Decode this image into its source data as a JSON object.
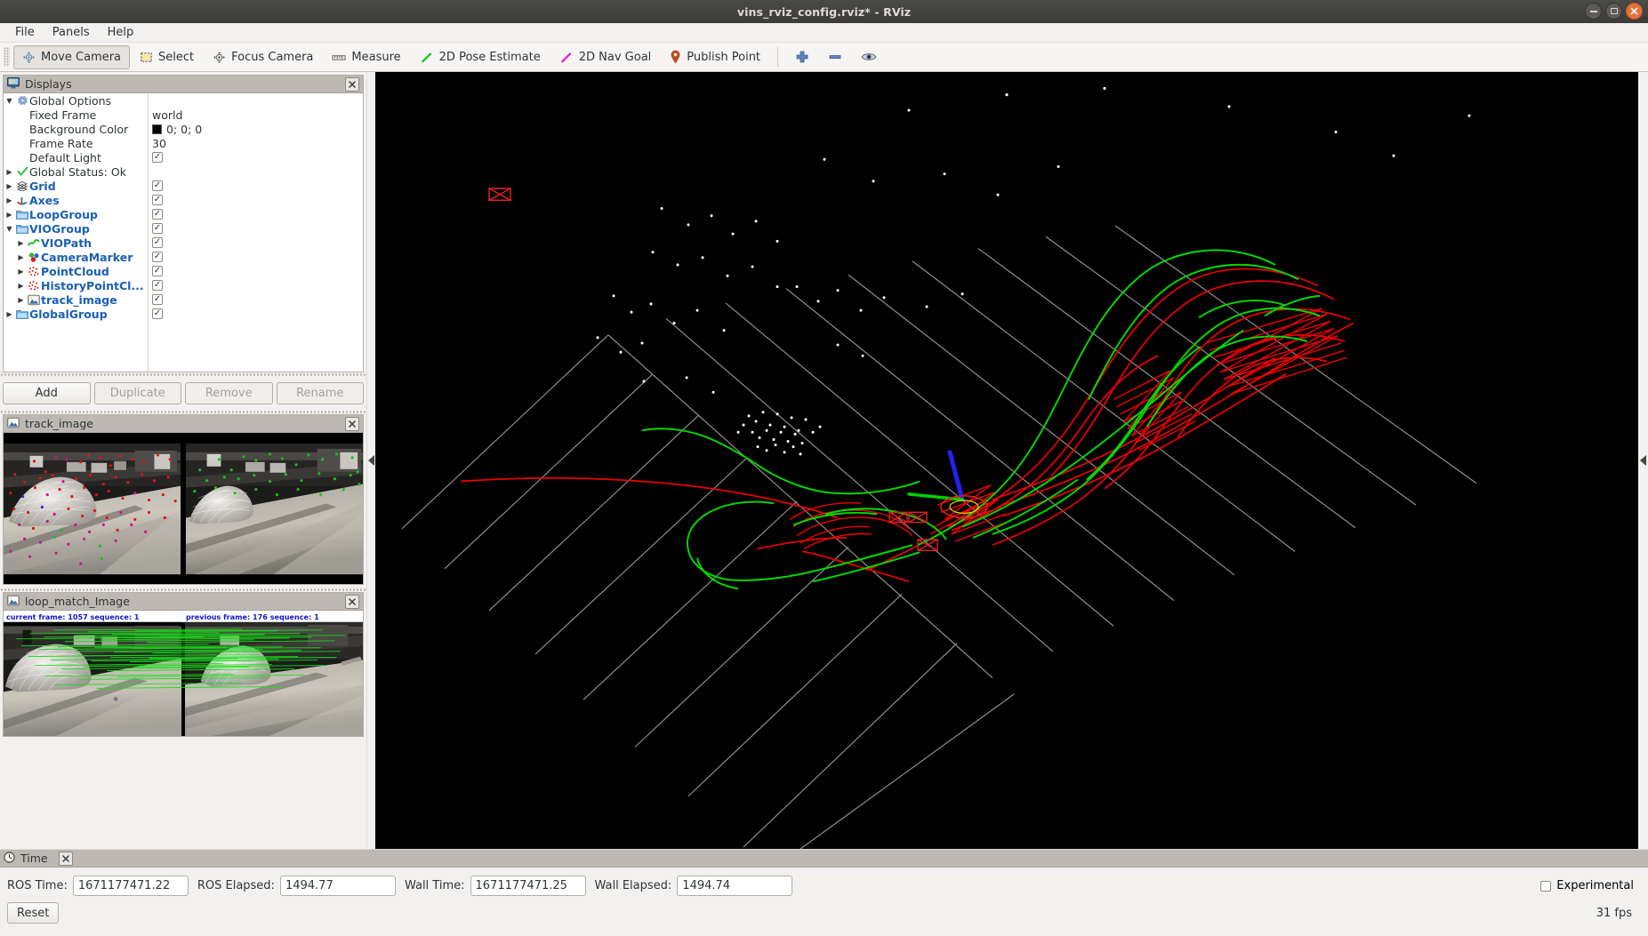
{
  "window": {
    "title": "vins_rviz_config.rviz* - RViz",
    "controls": {
      "minimize": "minimize-icon",
      "maximize": "maximize-icon",
      "close": "close-icon"
    }
  },
  "menu": {
    "items": [
      "File",
      "Panels",
      "Help"
    ]
  },
  "toolbar": {
    "buttons": [
      {
        "label": "Move Camera",
        "icon": "move-camera-icon",
        "active": true
      },
      {
        "label": "Select",
        "icon": "select-icon",
        "active": false
      },
      {
        "label": "Focus Camera",
        "icon": "focus-camera-icon",
        "active": false
      },
      {
        "label": "Measure",
        "icon": "measure-icon",
        "active": false
      },
      {
        "label": "2D Pose Estimate",
        "icon": "pose-estimate-icon",
        "active": false
      },
      {
        "label": "2D Nav Goal",
        "icon": "nav-goal-icon",
        "active": false
      },
      {
        "label": "Publish Point",
        "icon": "publish-point-icon",
        "active": false
      }
    ],
    "extra_icons": [
      "plus-icon",
      "minus-icon",
      "eye-icon"
    ]
  },
  "displays": {
    "panel_title": "Displays",
    "panel_icon": "display-monitor-icon",
    "close_label": "×",
    "tree": [
      {
        "indent": 0,
        "twisty": "down",
        "icon": "gear-icon",
        "label": "Global Options",
        "blue": false,
        "value_type": "none"
      },
      {
        "indent": 0,
        "twisty": "none",
        "icon": "none",
        "label": "Fixed Frame",
        "blue": false,
        "value_type": "text",
        "value": "world"
      },
      {
        "indent": 0,
        "twisty": "none",
        "icon": "none",
        "label": "Background Color",
        "blue": false,
        "value_type": "color",
        "value": "0; 0; 0",
        "color": "#000000"
      },
      {
        "indent": 0,
        "twisty": "none",
        "icon": "none",
        "label": "Frame Rate",
        "blue": false,
        "value_type": "text",
        "value": "30"
      },
      {
        "indent": 0,
        "twisty": "none",
        "icon": "none",
        "label": "Default Light",
        "blue": false,
        "value_type": "check",
        "checked": true
      },
      {
        "indent": 0,
        "twisty": "right",
        "icon": "check-icon",
        "label": "Global Status: Ok",
        "blue": false,
        "value_type": "none"
      },
      {
        "indent": 0,
        "twisty": "right",
        "icon": "grid-icon",
        "label": "Grid",
        "blue": true,
        "value_type": "check",
        "checked": true
      },
      {
        "indent": 0,
        "twisty": "right",
        "icon": "axes-icon",
        "label": "Axes",
        "blue": true,
        "value_type": "check",
        "checked": true
      },
      {
        "indent": 0,
        "twisty": "right",
        "icon": "folder-icon",
        "label": "LoopGroup",
        "blue": true,
        "value_type": "check",
        "checked": true
      },
      {
        "indent": 0,
        "twisty": "down",
        "icon": "folder-icon",
        "label": "VIOGroup",
        "blue": true,
        "value_type": "check",
        "checked": true
      },
      {
        "indent": 1,
        "twisty": "right",
        "icon": "path-icon",
        "label": "VIOPath",
        "blue": true,
        "value_type": "check",
        "checked": true
      },
      {
        "indent": 1,
        "twisty": "right",
        "icon": "marker-icon",
        "label": "CameraMarker",
        "blue": true,
        "value_type": "check",
        "checked": true
      },
      {
        "indent": 1,
        "twisty": "right",
        "icon": "pointcloud-icon",
        "label": "PointCloud",
        "blue": true,
        "value_type": "check",
        "checked": true
      },
      {
        "indent": 1,
        "twisty": "right",
        "icon": "pointcloud-icon",
        "label": "HistoryPointCl...",
        "blue": true,
        "value_type": "check",
        "checked": true
      },
      {
        "indent": 1,
        "twisty": "right",
        "icon": "image-icon",
        "label": "track_image",
        "blue": true,
        "value_type": "check",
        "checked": true
      },
      {
        "indent": 0,
        "twisty": "right",
        "icon": "folder-icon",
        "label": "GlobalGroup",
        "blue": true,
        "value_type": "check",
        "checked": true
      }
    ],
    "buttons": [
      {
        "label": "Add",
        "disabled": false
      },
      {
        "label": "Duplicate",
        "disabled": true
      },
      {
        "label": "Remove",
        "disabled": true
      },
      {
        "label": "Rename",
        "disabled": true
      }
    ]
  },
  "track_image_panel": {
    "title": "track_image",
    "icon": "image-icon",
    "close_label": "×"
  },
  "loop_match_panel": {
    "title": "loop_match_Image",
    "icon": "image-icon",
    "close_label": "×",
    "overlay_left": "current frame: 1057   sequence: 1",
    "overlay_right": "previous frame: 176   sequence: 1"
  },
  "viewport": {
    "background_color": "#000000",
    "grid_color": "#9a9a9a",
    "vio_path_color": "#00e000",
    "loop_path_color": "#f00000",
    "pointcloud_color": "#ffffff",
    "camera_axis_color": "#2222ee"
  },
  "time_panel": {
    "title": "Time",
    "icon": "clock-icon",
    "close_label": "×",
    "fields": [
      {
        "label": "ROS Time:",
        "value": "1671177471.22"
      },
      {
        "label": "ROS Elapsed:",
        "value": "1494.77"
      },
      {
        "label": "Wall Time:",
        "value": "1671177471.25"
      },
      {
        "label": "Wall Elapsed:",
        "value": "1494.74"
      }
    ],
    "experimental_label": "Experimental",
    "experimental_checked": false,
    "reset_label": "Reset",
    "fps": "31 fps"
  }
}
